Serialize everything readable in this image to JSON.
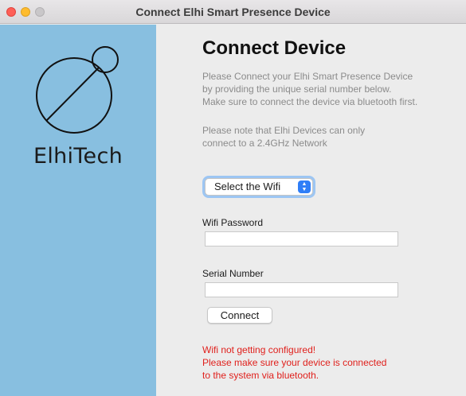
{
  "window": {
    "title": "Connect Elhi Smart Presence Device"
  },
  "sidebar": {
    "brand_name": "ElhiTech",
    "logo_icon": "elhitech-logo-icon",
    "background_color": "#88bfe0"
  },
  "main": {
    "heading": "Connect Device",
    "description_lines": [
      "Please Connect your Elhi Smart Presence Device",
      "by providing the unique serial number below.",
      "Make sure to connect the device via bluetooth first."
    ],
    "note_lines": [
      "Please note that Elhi Devices can only",
      "connect to a 2.4GHz Network"
    ],
    "wifi_select": {
      "selected_value": "Select the Wifi",
      "icon": "updown-chevron-icon"
    },
    "wifi_password": {
      "label": "Wifi Password",
      "value": ""
    },
    "serial_number": {
      "label": "Serial Number",
      "value": ""
    },
    "connect_button_label": "Connect",
    "error_lines": [
      "Wifi not getting configured!",
      "Please make sure your device is connected",
      "to the system via bluetooth."
    ],
    "error_color": "#e0201c"
  }
}
